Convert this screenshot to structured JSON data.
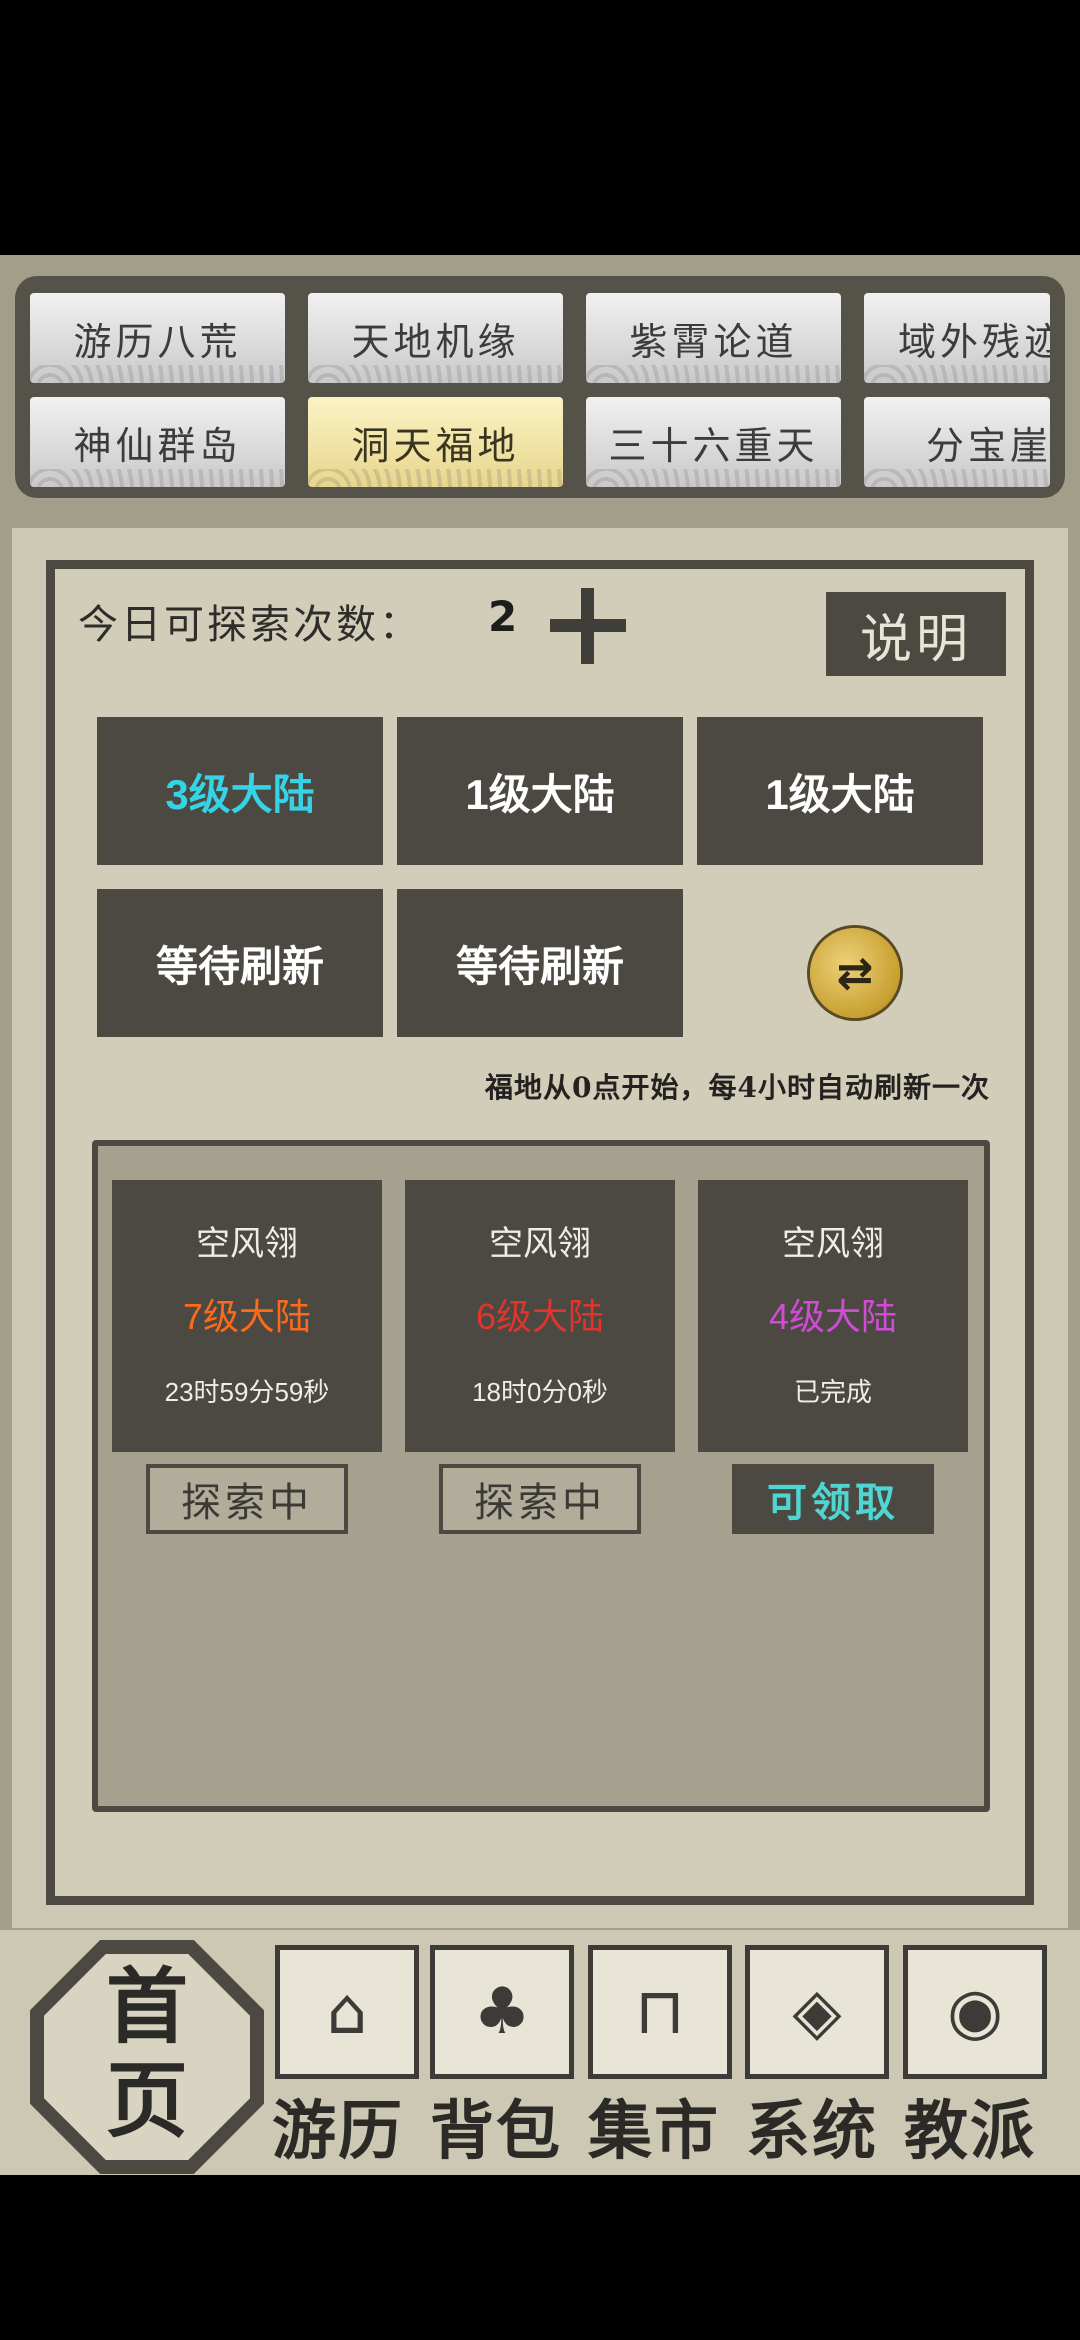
{
  "tabs": [
    {
      "label": "游历八荒",
      "active": false
    },
    {
      "label": "天地机缘",
      "active": false
    },
    {
      "label": "紫霄论道",
      "active": false
    },
    {
      "label": "域外残迹",
      "active": false
    },
    {
      "label": "神仙群岛",
      "active": false
    },
    {
      "label": "洞天福地",
      "active": true
    },
    {
      "label": "三十六重天",
      "active": false
    },
    {
      "label": "分宝崖",
      "active": false
    }
  ],
  "explore": {
    "label": "今日可探索次数：",
    "count": "2",
    "help_label": "说明"
  },
  "lands": [
    {
      "label": "3级大陆",
      "color": "#36d3e6"
    },
    {
      "label": "1级大陆",
      "color": "#ffffff"
    },
    {
      "label": "1级大陆",
      "color": "#ffffff"
    },
    {
      "label": "等待刷新",
      "color": "#ffffff"
    },
    {
      "label": "等待刷新",
      "color": "#ffffff"
    }
  ],
  "refresh_icon": "refresh-coin-icon",
  "notice": "福地从0点开始，每4小时自动刷新一次",
  "expeditions": [
    {
      "name": "空风翎",
      "level": "7级大陆",
      "level_color": "#ff6a1a",
      "time": "23时59分59秒",
      "status": "探索中",
      "claimable": false
    },
    {
      "name": "空风翎",
      "level": "6级大陆",
      "level_color": "#e0342c",
      "time": "18时0分0秒",
      "status": "探索中",
      "claimable": false
    },
    {
      "name": "空风翎",
      "level": "4级大陆",
      "level_color": "#d24bd6",
      "time": "已完成",
      "status": "可领取",
      "claimable": true
    }
  ],
  "nav": {
    "home_top": "首",
    "home_bottom": "页",
    "items": [
      {
        "label": "游历",
        "icon": "chest-icon"
      },
      {
        "label": "背包",
        "icon": "bag-icon"
      },
      {
        "label": "集市",
        "icon": "stall-icon"
      },
      {
        "label": "系统",
        "icon": "system-icon"
      },
      {
        "label": "教派",
        "icon": "sect-icon"
      }
    ]
  }
}
